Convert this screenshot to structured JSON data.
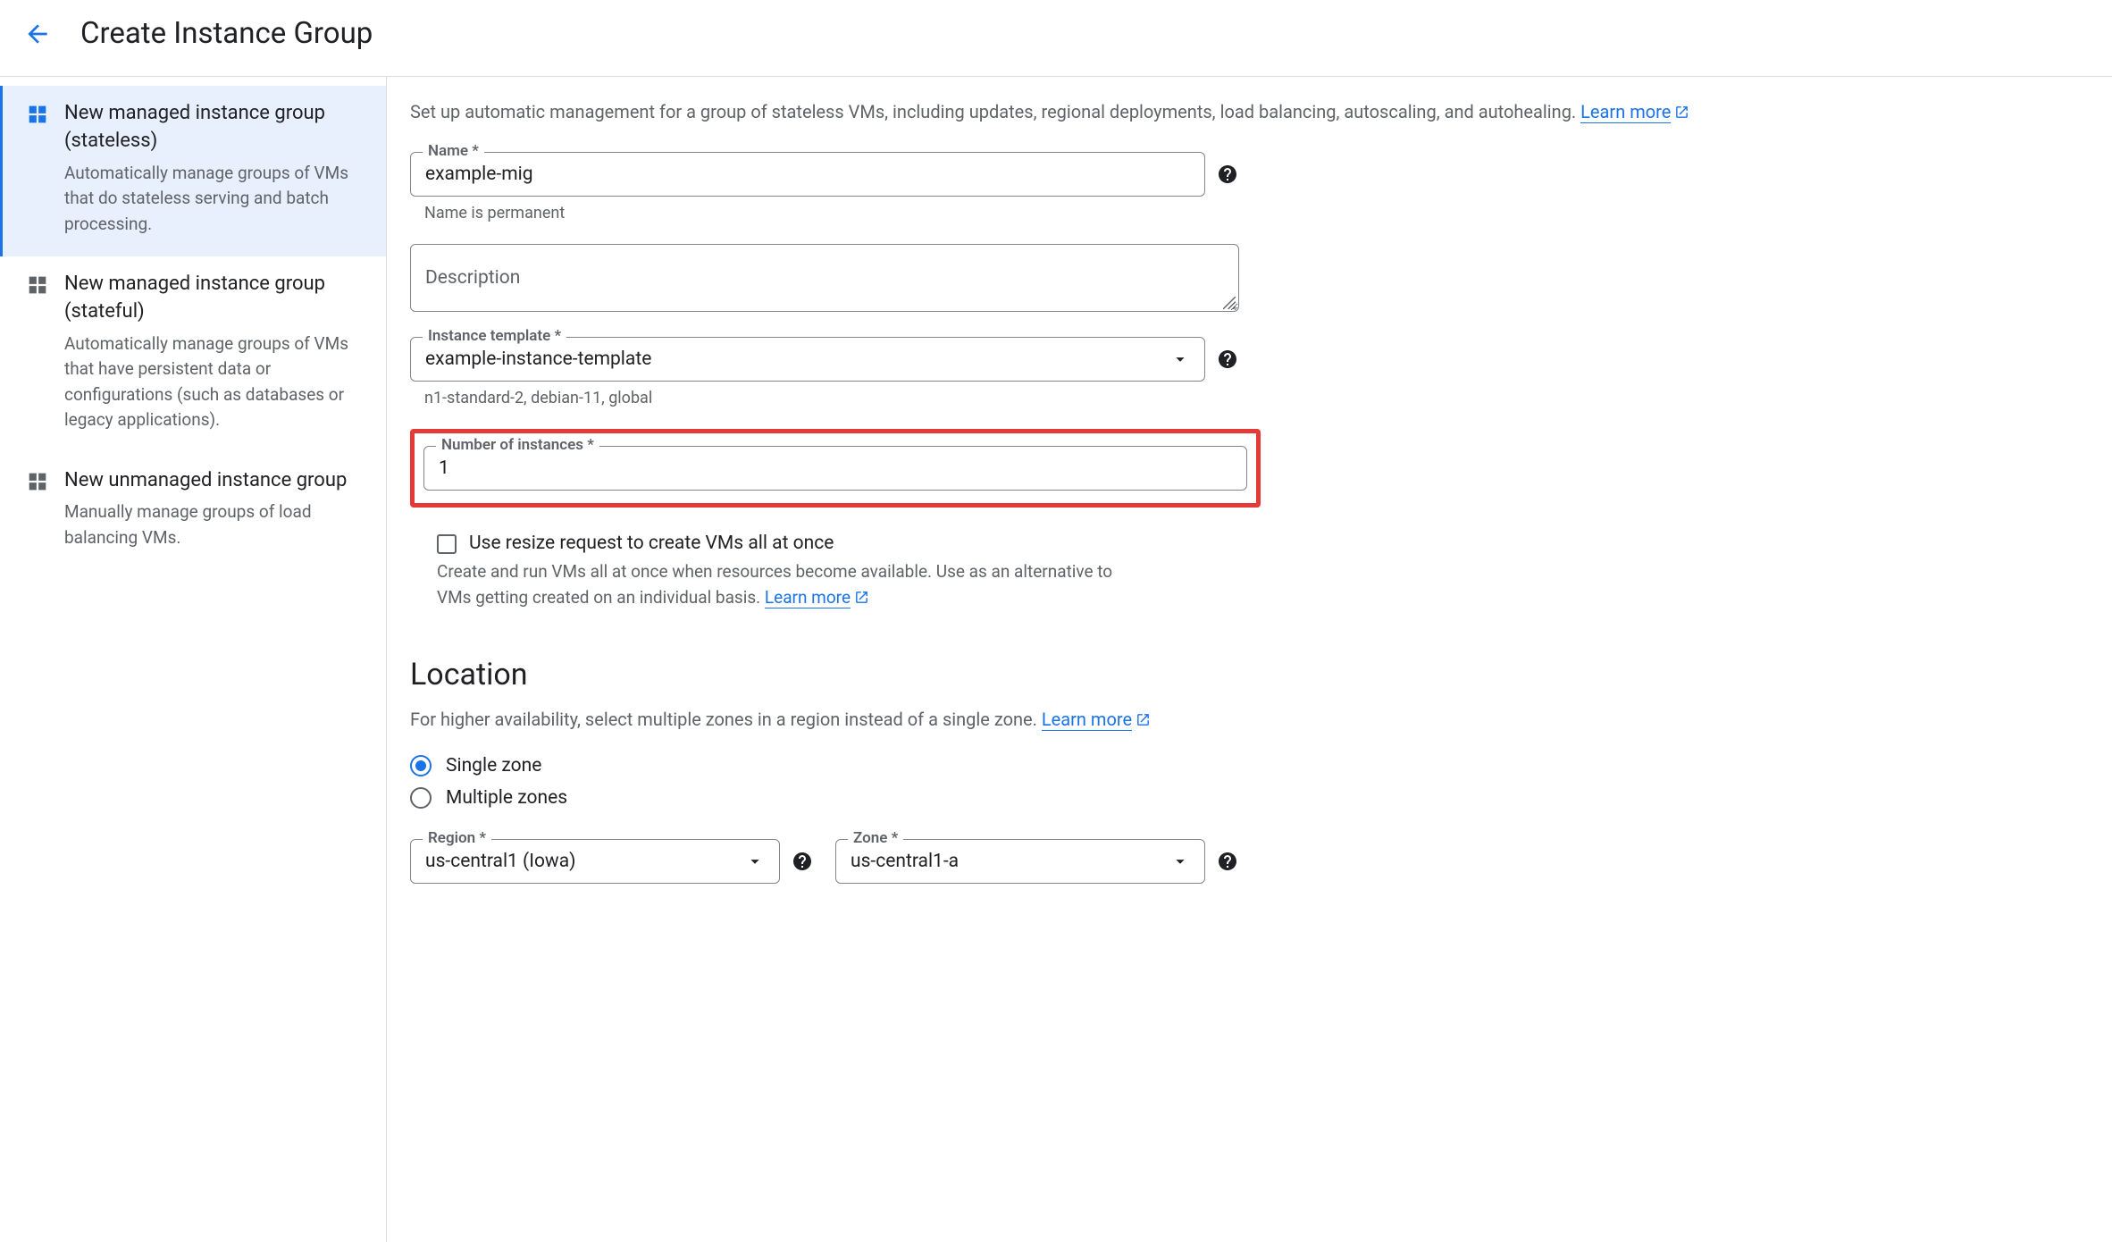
{
  "header": {
    "title": "Create Instance Group"
  },
  "sidebar": {
    "items": [
      {
        "title": "New managed instance group (stateless)",
        "desc": "Automatically manage groups of VMs that do stateless serving and batch processing.",
        "selected": true
      },
      {
        "title": "New managed instance group (stateful)",
        "desc": "Automatically manage groups of VMs that have persistent data or configurations (such as databases or legacy applications).",
        "selected": false
      },
      {
        "title": "New unmanaged instance group",
        "desc": "Manually manage groups of load balancing VMs.",
        "selected": false
      }
    ]
  },
  "main": {
    "intro_text": "Set up automatic management for a group of stateless VMs, including updates, regional deployments, load balancing, autoscaling, and autohealing. ",
    "intro_link": "Learn more",
    "name": {
      "label": "Name *",
      "value": "example-mig",
      "helper": "Name is permanent"
    },
    "description": {
      "placeholder": "Description"
    },
    "instance_template": {
      "label": "Instance template *",
      "value": "example-instance-template",
      "helper": "n1-standard-2, debian-11, global"
    },
    "num_instances": {
      "label": "Number of instances *",
      "value": "1"
    },
    "resize_request": {
      "checkbox_label": "Use resize request to create VMs all at once",
      "desc_text": "Create and run VMs all at once when resources become available. Use as an alternative to VMs getting created on an individual basis. ",
      "desc_link": "Learn more"
    },
    "location": {
      "title": "Location",
      "desc_text": "For higher availability, select multiple zones in a region instead of a single zone. ",
      "desc_link": "Learn more",
      "radio_single": "Single zone",
      "radio_multiple": "Multiple zones",
      "region": {
        "label": "Region *",
        "value": "us-central1 (Iowa)"
      },
      "zone": {
        "label": "Zone *",
        "value": "us-central1-a"
      }
    }
  }
}
